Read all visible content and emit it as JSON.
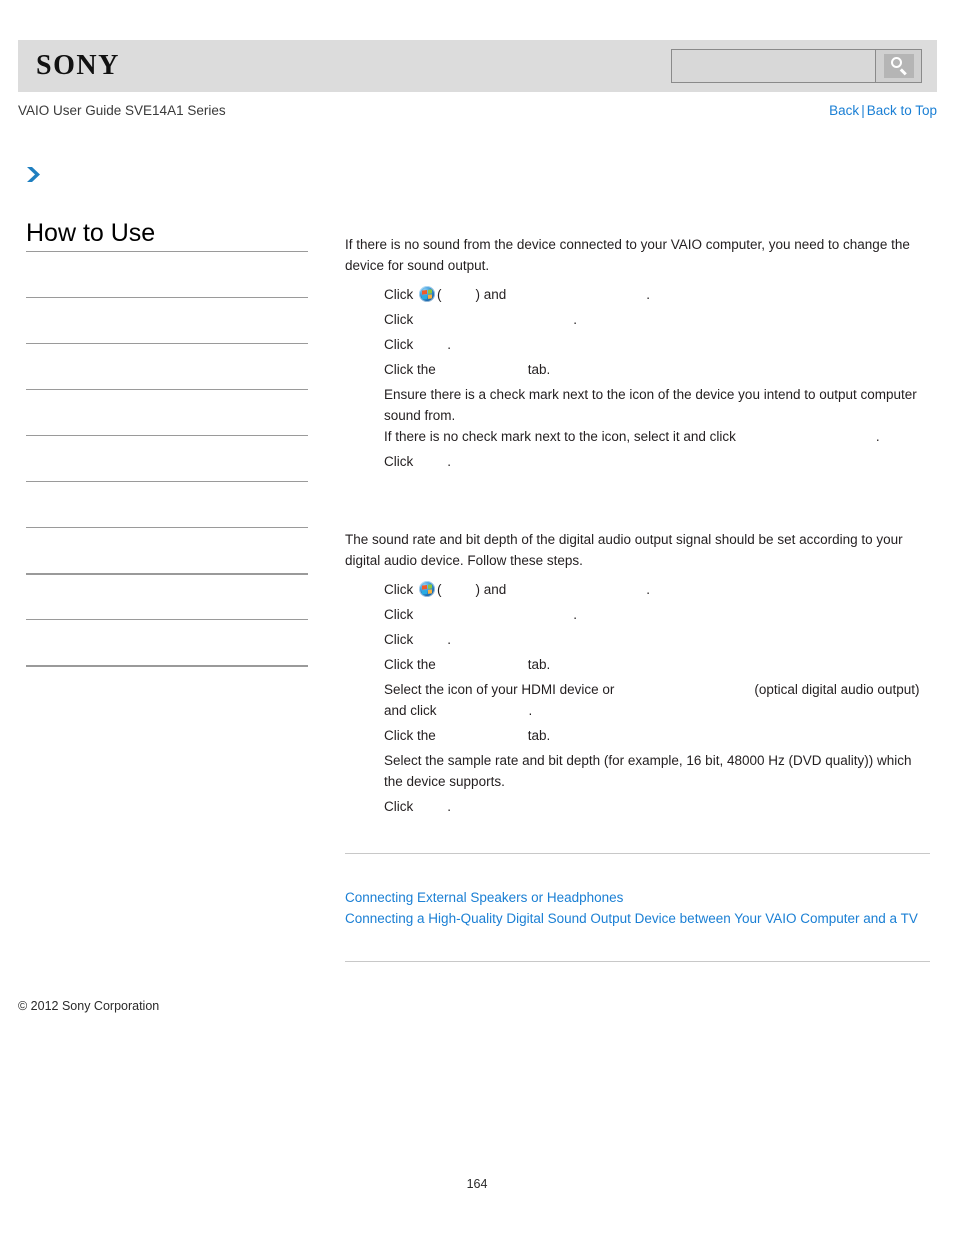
{
  "header": {
    "logo_text": "SONY",
    "search": {
      "value": "",
      "placeholder": "",
      "icon": "search-icon",
      "button_label": ""
    }
  },
  "title_bar": {
    "guide_title": "VAIO User Guide SVE14A1 Series",
    "back_label": "Back",
    "separator": "|",
    "back_to_top_label": "Back to Top"
  },
  "breadcrumb": {
    "icon": "chevron-right-icon"
  },
  "sidebar": {
    "heading": "How to Use",
    "items": [
      {
        "label": ""
      },
      {
        "label": ""
      },
      {
        "label": ""
      },
      {
        "label": ""
      },
      {
        "label": ""
      },
      {
        "label": ""
      },
      {
        "label": ""
      },
      {
        "label": ""
      },
      {
        "label": ""
      },
      {
        "label": ""
      }
    ]
  },
  "main": {
    "section1": {
      "intro": "If there is no sound from the device connected to your VAIO computer, you need to change the device for sound output.",
      "steps": [
        {
          "pre": "Click",
          "icon": "windows-start-orb-icon",
          "mid1": "(",
          "term1": "",
          "mid2": ") and",
          "term2": "",
          "post": "."
        },
        {
          "pre": "Click",
          "term1": "",
          "post": "."
        },
        {
          "pre": "Click",
          "term1": "",
          "post": "."
        },
        {
          "pre": "Click the",
          "term1": "",
          "post": "tab."
        },
        {
          "pre": "Ensure there is a check mark next to the icon of the device you intend to output computer sound from.",
          "line2_pre": "If there is no check mark next to the icon, select it and click",
          "term1": "",
          "post": "."
        },
        {
          "pre": "Click",
          "term1": "",
          "post": "."
        }
      ]
    },
    "section2": {
      "intro": "The sound rate and bit depth of the digital audio output signal should be set according to your digital audio device. Follow these steps.",
      "steps": [
        {
          "pre": "Click",
          "icon": "windows-start-orb-icon",
          "mid1": "(",
          "term1": "",
          "mid2": ") and",
          "term2": "",
          "post": "."
        },
        {
          "pre": "Click",
          "term1": "",
          "post": "."
        },
        {
          "pre": "Click",
          "term1": "",
          "post": "."
        },
        {
          "pre": "Click the",
          "term1": "",
          "post": "tab."
        },
        {
          "pre": "Select the icon of your HDMI device or",
          "term1": "",
          "mid1": "(optical digital audio output)",
          "line2_pre": "and click",
          "term2": "",
          "post": "."
        },
        {
          "pre": "Click the",
          "term1": "",
          "post": "tab."
        },
        {
          "pre": "Select the sample rate and bit depth (for example, 16 bit, 48000 Hz (DVD quality)) which the device supports."
        },
        {
          "pre": "Click",
          "term1": "",
          "post": "."
        }
      ]
    },
    "related_links": [
      "Connecting External Speakers or Headphones",
      "Connecting a High-Quality Digital Sound Output Device between Your VAIO Computer and a TV"
    ]
  },
  "footer": {
    "copyright": "© 2012 Sony Corporation",
    "page_number": "164"
  },
  "colors": {
    "header_bg": "#dcdcdc",
    "link_blue": "#1a7fd4",
    "rule_gray": "#9a9a9a",
    "text": "#231f20"
  }
}
